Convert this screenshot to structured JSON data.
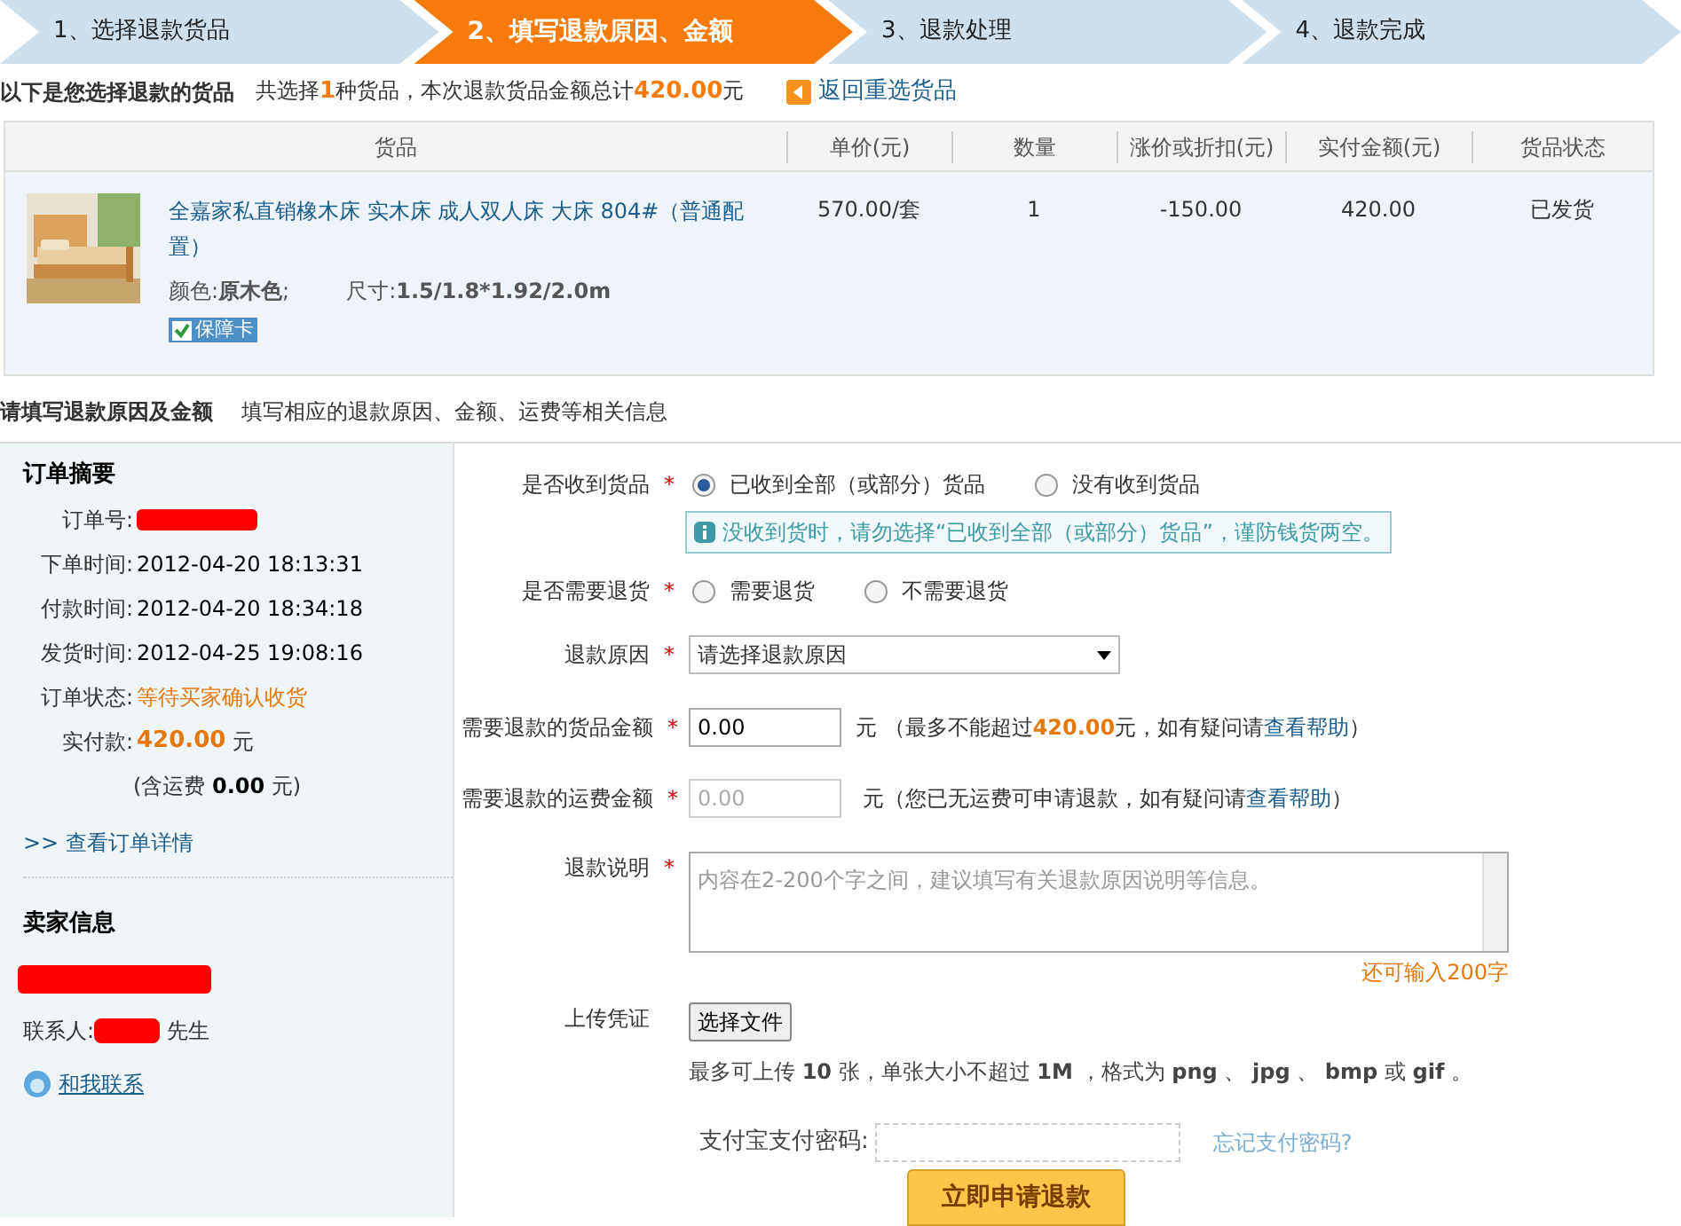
{
  "steps": [
    {
      "label": "1、选择退款货品",
      "selected": false
    },
    {
      "label": "2、填写退款原因、金额",
      "selected": true
    },
    {
      "label": "3、退款处理",
      "selected": false
    },
    {
      "label": "4、退款完成",
      "selected": false
    }
  ],
  "summary": {
    "title": "以下是您选择退款的货品",
    "text": "共选择**1**种货品，本次退款货品金额总计**420.00**元",
    "back_link": "返回重选货品"
  },
  "table": {
    "columns": [
      "货品",
      "单价(元)",
      "数量",
      "涨价或折扣(元)",
      "实付金额(元)",
      "货品状态"
    ],
    "rows": [
      {
        "product_name": "全嘉家私直销橡木床 实木床 成人双人床 大床 804#（普通配置）",
        "spec_color": "颜色:**原木色**;",
        "size": "尺寸:**1.5/1.8*1.92/2.0m**",
        "badge": "保障卡",
        "unit_price": "570.00/套",
        "quantity": "1",
        "discount": "-150.00",
        "paid": "420.00",
        "status": "已发货"
      }
    ]
  },
  "section": {
    "title": "请填写退款原因及金额",
    "hint": "填写相应的退款原因、金额、运费等相关信息"
  },
  "order_summary": {
    "title": "订单摘要",
    "fields": [
      {
        "label": "订单号:",
        "kind": "redacted"
      },
      {
        "label": "下单时间:",
        "kind": "text",
        "value": "2012-04-20 18:13:31"
      },
      {
        "label": "付款时间:",
        "kind": "text",
        "value": "2012-04-20 18:34:18"
      },
      {
        "label": "发货时间:",
        "kind": "text",
        "value": "2012-04-25 19:08:16"
      },
      {
        "label": "订单状态:",
        "kind": "status",
        "value": "等待买家确认收货"
      },
      {
        "label": "实付款:",
        "kind": "amount",
        "value": "420.00",
        "unit": "元"
      }
    ],
    "shipping_note": "(含运费 **0.00** 元)",
    "details_link": ">> 查看订单详情"
  },
  "seller": {
    "title": "卖家信息",
    "contact_label": "联系人:",
    "contact_suffix": "先生",
    "contact_link": "和我联系"
  },
  "form": [
    {
      "kind": "radio",
      "label": "是否收到货品",
      "required_mark": "*",
      "options": [
        {
          "label": "已收到全部（或部分）货品",
          "selected": true
        },
        {
          "label": "没有收到货品",
          "selected": false
        }
      ],
      "notice": "没收到货时，请勿选择“已收到全部（或部分）货品”，谨防钱货两空。"
    },
    {
      "kind": "radio",
      "label": "是否需要退货",
      "required_mark": "*",
      "options": [
        {
          "label": "需要退货",
          "selected": false
        },
        {
          "label": "不需要退货",
          "selected": false
        }
      ]
    },
    {
      "kind": "select",
      "label": "退款原因",
      "required_mark": "*",
      "value": "请选择退款原因"
    },
    {
      "kind": "amount",
      "label": "需要退款的货品金额",
      "required_mark": "*",
      "value": "0.00",
      "disabled": false,
      "note": "元 （最多不能超过**420.00**元，如有疑问请",
      "help_link": "查看帮助",
      "note_end": "）"
    },
    {
      "kind": "amount",
      "label": "需要退款的运费金额",
      "required_mark": "*",
      "value": "0.00",
      "disabled": true,
      "note": "元（您已无运费可申请退款，如有疑问请",
      "help_link": "查看帮助",
      "note_end": "）"
    },
    {
      "kind": "textarea",
      "label": "退款说明",
      "required_mark": "*",
      "placeholder": "内容在2-200个字之间，建议填写有关退款原因说明等信息。",
      "counter": "还可输入200字"
    },
    {
      "kind": "upload",
      "label": "上传凭证",
      "button": "选择文件",
      "note": "最多可上传 **10** 张，单张大小不超过 **1M** ，格式为 **png** 、 **jpg** 、 **bmp** 或 **gif** 。"
    }
  ],
  "payment": {
    "label": "支付宝支付密码:",
    "forgot_link": "忘记支付密码?",
    "submit": "立即申请退款"
  }
}
